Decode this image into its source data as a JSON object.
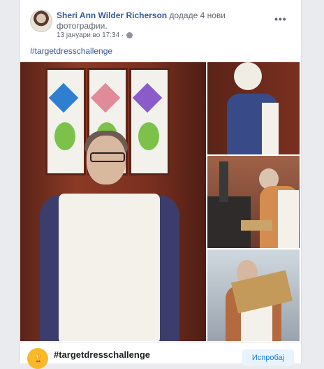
{
  "post": {
    "author": "Sheri Ann Wilder Richerson",
    "action": " додаде 4 нови фотографии.",
    "date": "13 јануари во 17:34 ·",
    "hashtag": "#targetdresschallenge",
    "more_icon": "more-horizontal-icon",
    "globe_icon": "globe-icon"
  },
  "footer": {
    "title": "#targetdresschallenge",
    "button": "Испробај"
  },
  "colors": {
    "link": "#385898",
    "button_bg": "#e7f3ff",
    "button_text": "#1877f2",
    "trophy": "#f7b928"
  }
}
